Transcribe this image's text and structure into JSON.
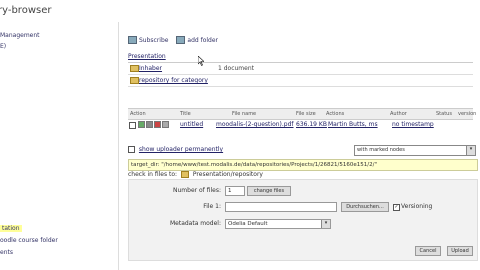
{
  "window": {
    "title": "ry-browser"
  },
  "sidebar": {
    "items": [
      {
        "label": "Management"
      },
      {
        "label": "E)"
      },
      {
        "label": "tation"
      },
      {
        "label": "oodle course folder"
      },
      {
        "label": "ents"
      }
    ]
  },
  "toolbar": {
    "subscribe_label": "Subscribe",
    "add_folder_label": "add folder"
  },
  "breadcrumb": {
    "label": "Presentation"
  },
  "folders": [
    {
      "name": "Inhaber",
      "description": "1 document"
    },
    {
      "name": "repository for category",
      "description": ""
    }
  ],
  "file_table": {
    "headers": [
      "Action",
      "Title",
      "File name",
      "File size",
      "Actions",
      "Author",
      "Status",
      "version"
    ],
    "rows": [
      {
        "title": "untitled",
        "file_name": "moodalis-(2-question).pdf",
        "size": "636.19 KB",
        "author": "Martin Butts, ms",
        "status": "no timestamp"
      }
    ]
  },
  "uploader": {
    "toggle_label": "show uploader permanently",
    "mode_select": "with marked nodes"
  },
  "target": {
    "path_text": "target_dir: \"/home/www/test.modalis.de/data/repositories/Projects/1/26821/5160e151/2/\""
  },
  "checkin": {
    "label": "check in files to:",
    "target_label": "Presentation/repository"
  },
  "form": {
    "num_files_label": "Number of files:",
    "num_files_value": "1",
    "change_button": "change files",
    "file_label": "File 1:",
    "browse_button": "Durchsuchen...",
    "versioning_label": "Versioning",
    "versioning_checked": true,
    "metadata_label": "Metadata model:",
    "metadata_value": "Odelia Default",
    "cancel_button": "Cancel",
    "upload_button": "Upload"
  }
}
